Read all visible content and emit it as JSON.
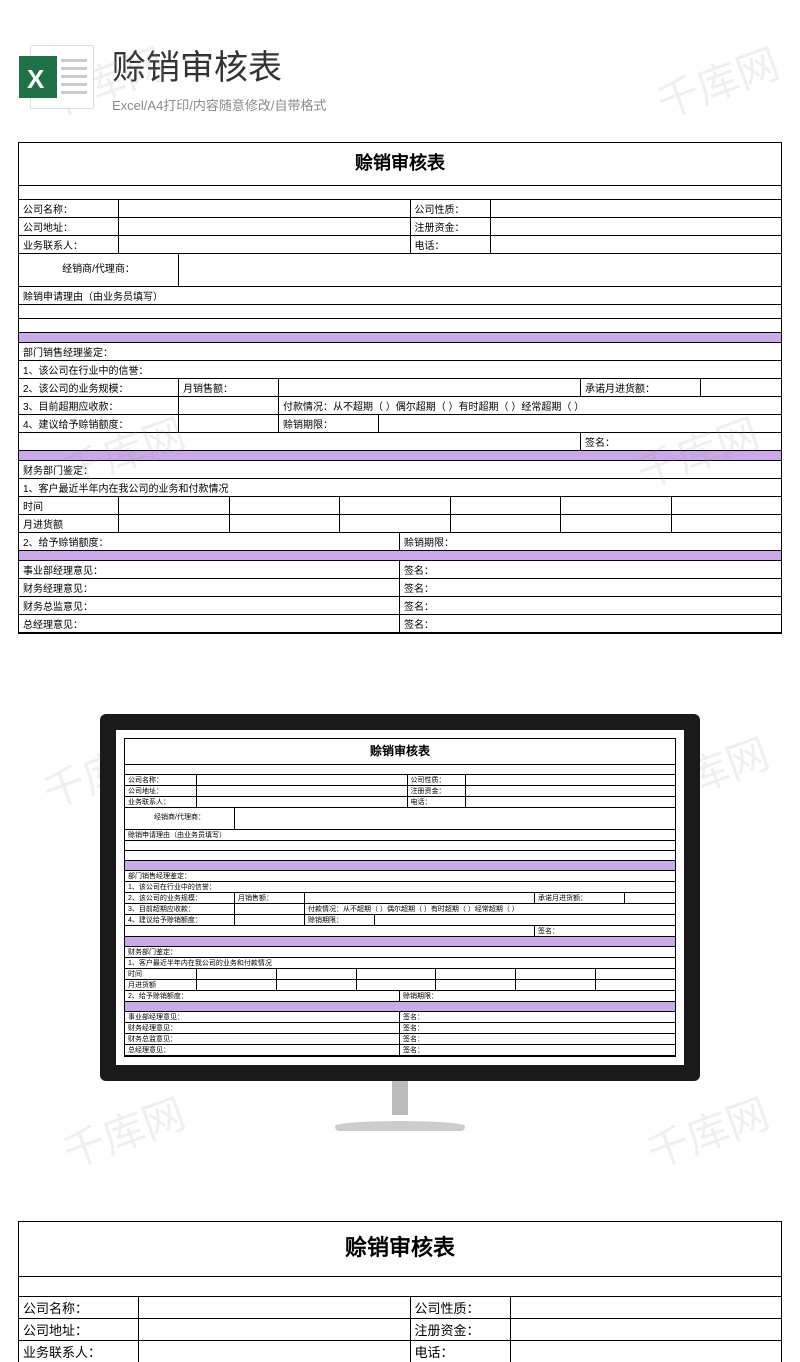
{
  "header": {
    "title": "赊销审核表",
    "subtitle": "Excel/A4打印/内容随意修改/自带格式"
  },
  "form": {
    "title": "赊销审核表",
    "company_name_lbl": "公司名称：",
    "company_nature_lbl": "公司性质：",
    "company_addr_lbl": "公司地址：",
    "reg_capital_lbl": "注册资金：",
    "contact_lbl": "业务联系人：",
    "phone_lbl": "电话：",
    "dealer_lbl": "经销商/代理商：",
    "reason_lbl": "赊销申请理由（由业务员填写）",
    "dept_mgr_lbl": "部门销售经理鉴定：",
    "q1": "1、该公司在行业中的信誉：",
    "q2": "2、该公司的业务规模：",
    "q2_monthly": "月销售额：",
    "q2_promise": "承诺月进货额：",
    "q3": "3、目前超期应收款：",
    "q3_pay": "付款情况：从不超期（ ）偶尔超期（ ）有时超期（ ）经常超期（ ）",
    "q4": "4、建议给予赊销额度：",
    "q4_period": "赊销期限：",
    "sign": "签名：",
    "finance_lbl": "财务部门鉴定：",
    "f1": "1、客户最近半年内在我公司的业务和付款情况",
    "time_lbl": "时间",
    "monthly_goods": "月进货额",
    "f2": "2、给予赊销额度：",
    "f2_period": "赊销期限：",
    "biz_mgr": "事业部经理意见：",
    "fin_mgr": "财务经理意见：",
    "fin_dir": "财务总监意见：",
    "gm": "总经理意见："
  },
  "watermark": "千库网"
}
